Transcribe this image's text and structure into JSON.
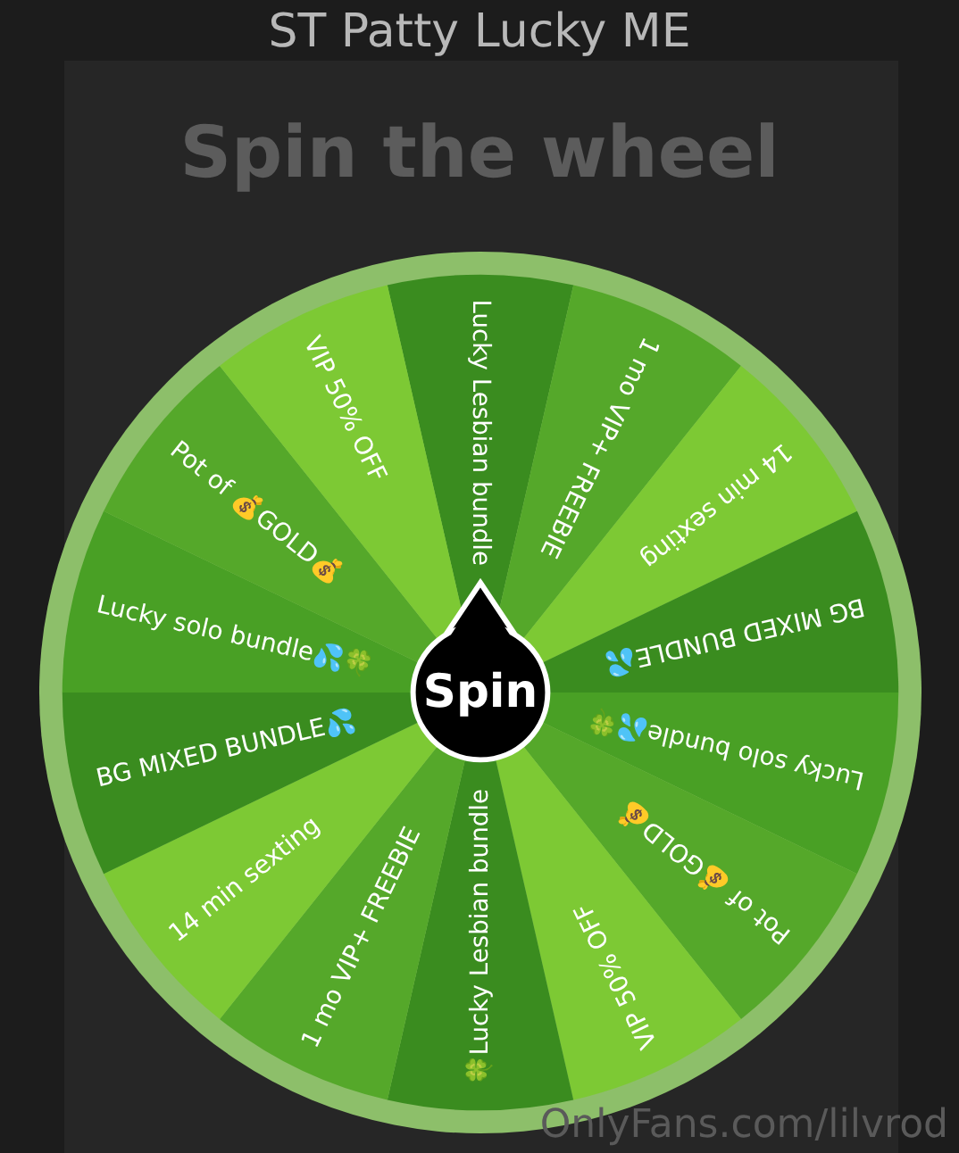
{
  "page_title": "ST Patty Lucky ME",
  "heading": "Spin the wheel",
  "wheel": {
    "slices": [
      {
        "label": "Lucky Lesbian bundle",
        "color": "#3a8c1f"
      },
      {
        "label": "1 mo VIP+ FREEBIE",
        "color": "#55a82a"
      },
      {
        "label": "14 min sexting",
        "color": "#7dc934"
      },
      {
        "label": "BG MIXED BUNDLE💦",
        "color": "#3a8c1f"
      },
      {
        "label": "Lucky solo bundle💦🍀",
        "color": "#49a025"
      },
      {
        "label": "Pot of 💰GOLD💰",
        "color": "#55a82a"
      },
      {
        "label": "VIP 50% OFF",
        "color": "#7dc934"
      },
      {
        "label": "🍀Lucky Lesbian bundle",
        "color": "#3a8c1f"
      },
      {
        "label": "1 mo VIP+ FREEBIE",
        "color": "#55a82a"
      },
      {
        "label": "14 min sexting",
        "color": "#7dc934"
      },
      {
        "label": "BG MIXED BUNDLE💦",
        "color": "#3a8c1f"
      },
      {
        "label": "Lucky solo bundle💦🍀",
        "color": "#49a025"
      },
      {
        "label": "Pot of 💰GOLD💰",
        "color": "#55a82a"
      },
      {
        "label": "VIP 50% OFF",
        "color": "#7dc934"
      }
    ],
    "button": "Spin"
  },
  "footer": "OnlyFans.com/lilvrod"
}
